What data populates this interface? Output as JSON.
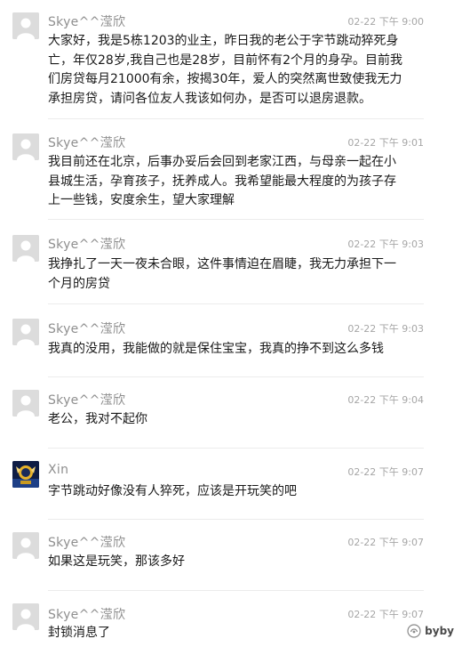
{
  "messages": [
    {
      "name": "Skye^^滢欣",
      "time": "02-22 下午 9:00",
      "avatar": "default-avatar",
      "text": "大家好，我是5栋1203的业主，昨日我的老公于字节跳动猝死身亡，年仅28岁,我自己也是28岁，目前怀有2个月的身孕。目前我们房贷每月21000有余，按揭30年，爱人的突然离世致使我无力承担房贷，请问各位友人我该如何办，是否可以退房退款。"
    },
    {
      "name": "Skye^^滢欣",
      "time": "02-22 下午 9:01",
      "avatar": "default-avatar",
      "text": "我目前还在北京，后事办妥后会回到老家江西，与母亲一起在小县城生活，孕育孩子，抚养成人。我希望能最大程度的为孩子存上一些钱，安度余生，望大家理解"
    },
    {
      "name": "Skye^^滢欣",
      "time": "02-22 下午 9:03",
      "avatar": "default-avatar",
      "text": "我挣扎了一天一夜未合眼，这件事情迫在眉睫，我无力承担下一个月的房贷"
    },
    {
      "name": "Skye^^滢欣",
      "time": "02-22 下午 9:03",
      "avatar": "default-avatar",
      "text": "我真的没用，我能做的就是保住宝宝，我真的挣不到这么多钱"
    },
    {
      "name": "Skye^^滢欣",
      "time": "02-22 下午 9:04",
      "avatar": "default-avatar",
      "text": "老公，我对不起你"
    },
    {
      "name": "Xin",
      "time": "02-22 下午 9:07",
      "avatar": "photo-avatar",
      "text": "字节跳动好像没有人猝死，应该是开玩笑的吧"
    },
    {
      "name": "Skye^^滢欣",
      "time": "02-22 下午 9:07",
      "avatar": "default-avatar",
      "text": "如果这是玩笑，那该多好"
    },
    {
      "name": "Skye^^滢欣",
      "time": "02-22 下午 9:07",
      "avatar": "default-avatar",
      "text": "封锁消息了"
    }
  ],
  "watermark": {
    "text": "byby",
    "icon": "wechat-channel-icon"
  }
}
